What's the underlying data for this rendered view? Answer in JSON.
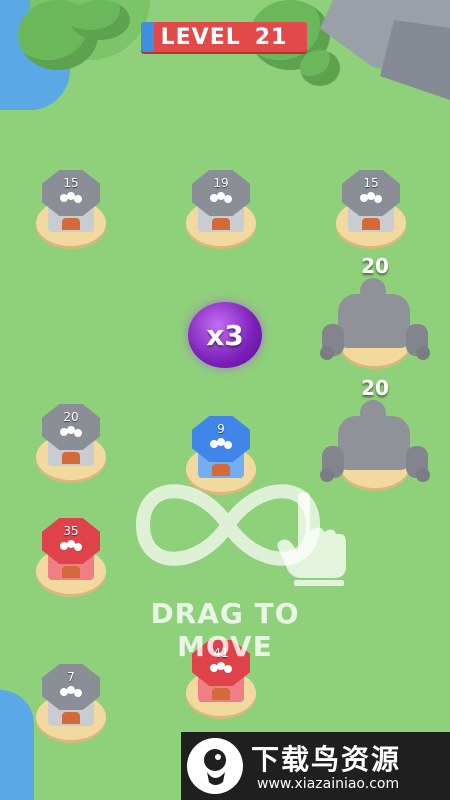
{
  "level": {
    "label": "LEVEL",
    "number": "21",
    "progress": 0.08
  },
  "towers": [
    {
      "count": "15",
      "color": "gray"
    },
    {
      "count": "19",
      "color": "gray"
    },
    {
      "count": "15",
      "color": "gray"
    },
    {
      "count": "20",
      "color": "gray"
    },
    {
      "count": "9",
      "color": "blue"
    },
    {
      "count": "35",
      "color": "red"
    },
    {
      "count": "7",
      "color": "gray"
    },
    {
      "count": "41",
      "color": "red"
    }
  ],
  "golems": [
    {
      "count": "20"
    },
    {
      "count": "20"
    }
  ],
  "powerup": {
    "label": "x3"
  },
  "hint": {
    "text": "DRAG TO MOVE"
  },
  "watermark": {
    "title": "下载鸟资源",
    "url": "www.xiazainiao.com"
  },
  "colors": {
    "grass": "#8fd17a",
    "water": "#5aa9e6",
    "level_bg": "#e24a4a",
    "level_progress": "#3f8fe0"
  }
}
